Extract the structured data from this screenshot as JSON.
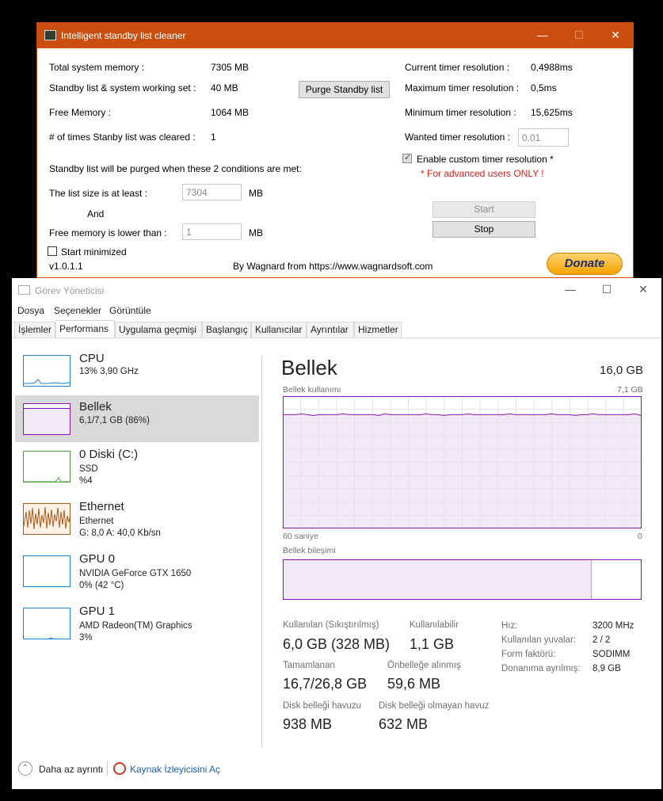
{
  "standby_window": {
    "title": "Intelligent standby list cleaner",
    "window_controls": {
      "minimize": "—",
      "maximize": "☐",
      "close": "✕"
    },
    "labels": {
      "total_memory": "Total system memory :",
      "standby_ws": "Standby list & system working set :",
      "free_memory": "Free Memory :",
      "times_cleared": "# of times Stanby list was cleared :",
      "conditions": "Standby list will be purged when these 2 conditions are met:",
      "list_size": "The list size is at least :",
      "and": "And",
      "free_lower": "Free memory is lower than :",
      "mb1": "MB",
      "mb2": "MB",
      "current_timer": "Current timer resolution :",
      "max_timer": "Maximum timer resolution :",
      "min_timer": "Minimum timer resolution :",
      "wanted_timer": "Wanted timer resolution :",
      "enable_custom": "Enable custom timer resolution *",
      "advanced_warning": "* For advanced users ONLY !",
      "start_minimized": "Start minimized",
      "version": "v1.0.1.1",
      "credit": "By Wagnard from https://www.wagnardsoft.com"
    },
    "values": {
      "total_memory": "7305 MB",
      "standby_ws": "40 MB",
      "free_memory": "1064 MB",
      "times_cleared": "1",
      "current_timer": "0,4988ms",
      "max_timer": "0,5ms",
      "min_timer": "15,625ms"
    },
    "inputs": {
      "list_size": "7304",
      "free_lower": "1",
      "wanted_timer": "0.01"
    },
    "checkboxes": {
      "enable_custom": true,
      "start_minimized": false
    },
    "buttons": {
      "purge": "Purge Standby list",
      "start": "Start",
      "stop": "Stop",
      "donate": "Donate"
    },
    "colors": {
      "titlebar": "#ca4f0f",
      "warning": "#e0201b"
    }
  },
  "task_manager": {
    "title": "Görev Yöneticisi",
    "window_controls": {
      "minimize": "—",
      "maximize": "☐",
      "close": "✕"
    },
    "menu": [
      "Dosya",
      "Seçenekler",
      "Görüntüle"
    ],
    "tabs": [
      "İşlemler",
      "Performans",
      "Uygulama geçmişi",
      "Başlangıç",
      "Kullanıcılar",
      "Ayrıntılar",
      "Hizmetler"
    ],
    "active_tab": "Performans",
    "perf_items": [
      {
        "name": "CPU",
        "sub1": "13% 3,90 GHz",
        "sub2": ""
      },
      {
        "name": "Bellek",
        "sub1": "6,1/7,1 GB (86%)",
        "sub2": ""
      },
      {
        "name": "0 Diski (C:)",
        "sub1": "SSD",
        "sub2": "%4"
      },
      {
        "name": "Ethernet",
        "sub1": "Ethernet",
        "sub2": "G: 8,0 A: 40,0 Kb/sn"
      },
      {
        "name": "GPU 0",
        "sub1": "NVIDIA GeForce GTX 1650",
        "sub2": "0% (42 °C)"
      },
      {
        "name": "GPU 1",
        "sub1": "AMD Radeon(TM) Graphics",
        "sub2": "3%"
      }
    ],
    "memory": {
      "heading": "Bellek",
      "total": "16,0 GB",
      "usage_label": "Bellek kullanımı",
      "usage_max": "7,1 GB",
      "axis_left": "60 saniye",
      "axis_right": "0",
      "usage_level": 0.86,
      "composition_label": "Bellek bileşimi",
      "in_use_label": "Kullanılan (Sıkıştırılmış)",
      "in_use_value": "6,0 GB (328 MB)",
      "available_label": "Kullanılabilir",
      "available_value": "1,1 GB",
      "committed_label": "Tamamlanan",
      "committed_value": "16,7/26,8 GB",
      "cached_label": "Önbelleğe alınmış",
      "cached_value": "59,6 MB",
      "paged_label": "Disk belleği havuzu",
      "paged_value": "938 MB",
      "nonpaged_label": "Disk belleği olmayan havuz",
      "nonpaged_value": "632 MB",
      "details": [
        {
          "label": "Hız:",
          "value": "3200 MHz"
        },
        {
          "label": "Kullanılan yuvalar:",
          "value": "2 / 2"
        },
        {
          "label": "Form faktörü:",
          "value": "SODIMM"
        },
        {
          "label": "Donanıma ayrılmış:",
          "value": "8,9 GB"
        }
      ],
      "colors": {
        "accent": "#8b12ae",
        "grid": "#ecdef0",
        "fill": "#f1eaf4"
      }
    },
    "footer": {
      "less_details": "Daha az ayrıntı",
      "resource_monitor": "Kaynak İzleyicisini Aç"
    }
  }
}
